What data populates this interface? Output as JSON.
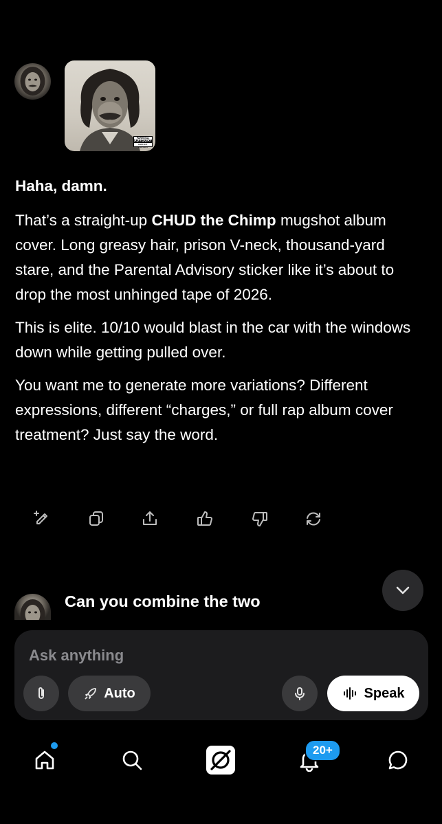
{
  "response": {
    "heading": "Haha, damn.",
    "p1_pre": "That’s a straight-up ",
    "p1_bold": "CHUD the Chimp",
    "p1_post": " mugshot album cover. Long greasy hair, prison V-neck, thousand-yard stare, and the Parental Advisory sticker like it’s about to drop the most unhinged tape of 2026.",
    "p2": "This is elite. 10/10 would blast in the car with the windows down while getting pulled over.",
    "p3": "You want me to generate more variations? Different expressions, different “charges,” or full rap album cover treatment? Just say the word."
  },
  "album_sticker": {
    "line1": "PARENTAL",
    "line2": "ADVISORY",
    "line3": "EXPLICIT CONTENT"
  },
  "actions": [
    "edit-icon",
    "copy-icon",
    "share-icon",
    "thumbs-up-icon",
    "thumbs-down-icon",
    "regenerate-icon"
  ],
  "user_message": "Can you combine the two",
  "composer": {
    "placeholder": "Ask anything",
    "mode_label": "Auto",
    "speak_label": "Speak"
  },
  "nav": {
    "notifications_badge": "20+",
    "items": [
      "home-icon",
      "search-icon",
      "grok-icon",
      "notifications-icon",
      "messages-icon"
    ]
  },
  "colors": {
    "background": "#000000",
    "composer_bg": "#1c1c1e",
    "chip_bg": "#3a3a3c",
    "accent": "#1d9bf0"
  }
}
